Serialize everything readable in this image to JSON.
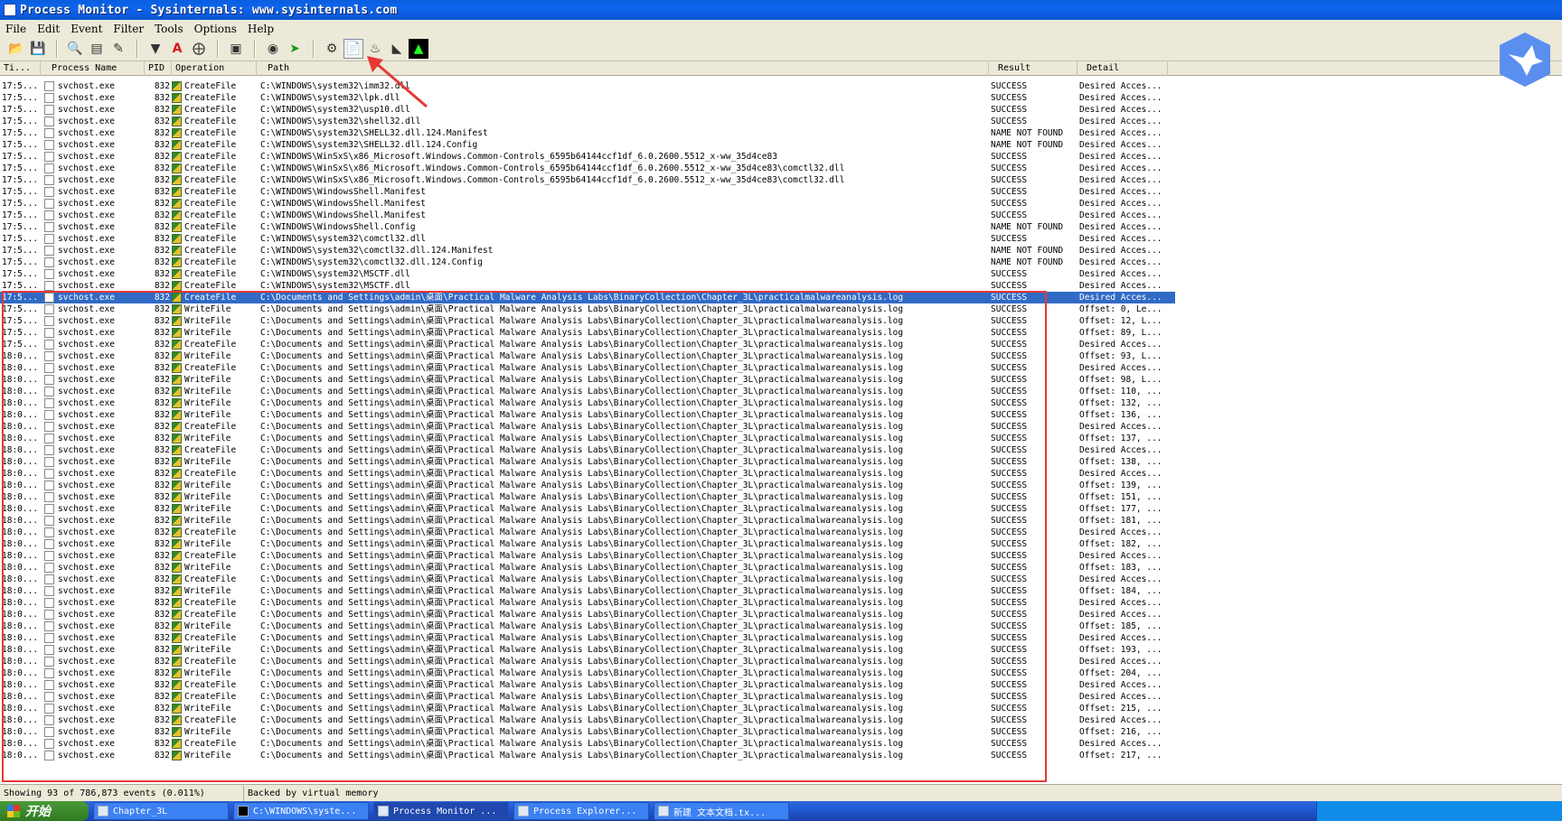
{
  "window": {
    "title": "Process Monitor - Sysinternals: www.sysinternals.com"
  },
  "menu": [
    "File",
    "Edit",
    "Event",
    "Filter",
    "Tools",
    "Options",
    "Help"
  ],
  "toolbar": {
    "buttons": [
      "open-icon",
      "save-icon",
      "magnify-icon",
      "autoscroll-icon",
      "clear-icon",
      "filter-icon",
      "highlight-icon",
      "network-icon",
      "jump-icon",
      "find-icon",
      "jump-to-icon",
      "registry-icon",
      "file-system-icon",
      "network-activity-icon",
      "process-activity-icon",
      "profiling-icon"
    ]
  },
  "columns": [
    "Ti...",
    "Process Name",
    "PID",
    "Operation",
    "Path",
    "Result",
    "Detail"
  ],
  "rows": [
    [
      "17:5...",
      "svchost.exe",
      "832",
      "CreateFile",
      "C:\\WINDOWS\\system32\\imm32.dll",
      "SUCCESS",
      "Desired Acces..."
    ],
    [
      "17:5...",
      "svchost.exe",
      "832",
      "CreateFile",
      "C:\\WINDOWS\\system32\\lpk.dll",
      "SUCCESS",
      "Desired Acces..."
    ],
    [
      "17:5...",
      "svchost.exe",
      "832",
      "CreateFile",
      "C:\\WINDOWS\\system32\\usp10.dll",
      "SUCCESS",
      "Desired Acces..."
    ],
    [
      "17:5...",
      "svchost.exe",
      "832",
      "CreateFile",
      "C:\\WINDOWS\\system32\\shell32.dll",
      "SUCCESS",
      "Desired Acces..."
    ],
    [
      "17:5...",
      "svchost.exe",
      "832",
      "CreateFile",
      "C:\\WINDOWS\\system32\\SHELL32.dll.124.Manifest",
      "NAME NOT FOUND",
      "Desired Acces..."
    ],
    [
      "17:5...",
      "svchost.exe",
      "832",
      "CreateFile",
      "C:\\WINDOWS\\system32\\SHELL32.dll.124.Config",
      "NAME NOT FOUND",
      "Desired Acces..."
    ],
    [
      "17:5...",
      "svchost.exe",
      "832",
      "CreateFile",
      "C:\\WINDOWS\\WinSxS\\x86_Microsoft.Windows.Common-Controls_6595b64144ccf1df_6.0.2600.5512_x-ww_35d4ce83",
      "SUCCESS",
      "Desired Acces..."
    ],
    [
      "17:5...",
      "svchost.exe",
      "832",
      "CreateFile",
      "C:\\WINDOWS\\WinSxS\\x86_Microsoft.Windows.Common-Controls_6595b64144ccf1df_6.0.2600.5512_x-ww_35d4ce83\\comctl32.dll",
      "SUCCESS",
      "Desired Acces..."
    ],
    [
      "17:5...",
      "svchost.exe",
      "832",
      "CreateFile",
      "C:\\WINDOWS\\WinSxS\\x86_Microsoft.Windows.Common-Controls_6595b64144ccf1df_6.0.2600.5512_x-ww_35d4ce83\\comctl32.dll",
      "SUCCESS",
      "Desired Acces..."
    ],
    [
      "17:5...",
      "svchost.exe",
      "832",
      "CreateFile",
      "C:\\WINDOWS\\WindowsShell.Manifest",
      "SUCCESS",
      "Desired Acces..."
    ],
    [
      "17:5...",
      "svchost.exe",
      "832",
      "CreateFile",
      "C:\\WINDOWS\\WindowsShell.Manifest",
      "SUCCESS",
      "Desired Acces..."
    ],
    [
      "17:5...",
      "svchost.exe",
      "832",
      "CreateFile",
      "C:\\WINDOWS\\WindowsShell.Manifest",
      "SUCCESS",
      "Desired Acces..."
    ],
    [
      "17:5...",
      "svchost.exe",
      "832",
      "CreateFile",
      "C:\\WINDOWS\\WindowsShell.Config",
      "NAME NOT FOUND",
      "Desired Acces..."
    ],
    [
      "17:5...",
      "svchost.exe",
      "832",
      "CreateFile",
      "C:\\WINDOWS\\system32\\comctl32.dll",
      "SUCCESS",
      "Desired Acces..."
    ],
    [
      "17:5...",
      "svchost.exe",
      "832",
      "CreateFile",
      "C:\\WINDOWS\\system32\\comctl32.dll.124.Manifest",
      "NAME NOT FOUND",
      "Desired Acces..."
    ],
    [
      "17:5...",
      "svchost.exe",
      "832",
      "CreateFile",
      "C:\\WINDOWS\\system32\\comctl32.dll.124.Config",
      "NAME NOT FOUND",
      "Desired Acces..."
    ],
    [
      "17:5...",
      "svchost.exe",
      "832",
      "CreateFile",
      "C:\\WINDOWS\\system32\\MSCTF.dll",
      "SUCCESS",
      "Desired Acces..."
    ],
    [
      "17:5...",
      "svchost.exe",
      "832",
      "CreateFile",
      "C:\\WINDOWS\\system32\\MSCTF.dll",
      "SUCCESS",
      "Desired Acces..."
    ],
    [
      "17:5...",
      "svchost.exe",
      "832",
      "CreateFile",
      "C:\\Documents and Settings\\admin\\桌面\\Practical Malware Analysis Labs\\BinaryCollection\\Chapter_3L\\practicalmalwareanalysis.log",
      "SUCCESS",
      "Desired Acces..."
    ],
    [
      "17:5...",
      "svchost.exe",
      "832",
      "WriteFile",
      "C:\\Documents and Settings\\admin\\桌面\\Practical Malware Analysis Labs\\BinaryCollection\\Chapter_3L\\practicalmalwareanalysis.log",
      "SUCCESS",
      "Offset: 0, Le..."
    ],
    [
      "17:5...",
      "svchost.exe",
      "832",
      "WriteFile",
      "C:\\Documents and Settings\\admin\\桌面\\Practical Malware Analysis Labs\\BinaryCollection\\Chapter_3L\\practicalmalwareanalysis.log",
      "SUCCESS",
      "Offset: 12, L..."
    ],
    [
      "17:5...",
      "svchost.exe",
      "832",
      "WriteFile",
      "C:\\Documents and Settings\\admin\\桌面\\Practical Malware Analysis Labs\\BinaryCollection\\Chapter_3L\\practicalmalwareanalysis.log",
      "SUCCESS",
      "Offset: 89, L..."
    ],
    [
      "17:5...",
      "svchost.exe",
      "832",
      "CreateFile",
      "C:\\Documents and Settings\\admin\\桌面\\Practical Malware Analysis Labs\\BinaryCollection\\Chapter_3L\\practicalmalwareanalysis.log",
      "SUCCESS",
      "Desired Acces..."
    ],
    [
      "18:0...",
      "svchost.exe",
      "832",
      "WriteFile",
      "C:\\Documents and Settings\\admin\\桌面\\Practical Malware Analysis Labs\\BinaryCollection\\Chapter_3L\\practicalmalwareanalysis.log",
      "SUCCESS",
      "Offset: 93, L..."
    ],
    [
      "18:0...",
      "svchost.exe",
      "832",
      "CreateFile",
      "C:\\Documents and Settings\\admin\\桌面\\Practical Malware Analysis Labs\\BinaryCollection\\Chapter_3L\\practicalmalwareanalysis.log",
      "SUCCESS",
      "Desired Acces..."
    ],
    [
      "18:0...",
      "svchost.exe",
      "832",
      "WriteFile",
      "C:\\Documents and Settings\\admin\\桌面\\Practical Malware Analysis Labs\\BinaryCollection\\Chapter_3L\\practicalmalwareanalysis.log",
      "SUCCESS",
      "Offset: 98, L..."
    ],
    [
      "18:0...",
      "svchost.exe",
      "832",
      "WriteFile",
      "C:\\Documents and Settings\\admin\\桌面\\Practical Malware Analysis Labs\\BinaryCollection\\Chapter_3L\\practicalmalwareanalysis.log",
      "SUCCESS",
      "Offset: 110, ..."
    ],
    [
      "18:0...",
      "svchost.exe",
      "832",
      "WriteFile",
      "C:\\Documents and Settings\\admin\\桌面\\Practical Malware Analysis Labs\\BinaryCollection\\Chapter_3L\\practicalmalwareanalysis.log",
      "SUCCESS",
      "Offset: 132, ..."
    ],
    [
      "18:0...",
      "svchost.exe",
      "832",
      "WriteFile",
      "C:\\Documents and Settings\\admin\\桌面\\Practical Malware Analysis Labs\\BinaryCollection\\Chapter_3L\\practicalmalwareanalysis.log",
      "SUCCESS",
      "Offset: 136, ..."
    ],
    [
      "18:0...",
      "svchost.exe",
      "832",
      "CreateFile",
      "C:\\Documents and Settings\\admin\\桌面\\Practical Malware Analysis Labs\\BinaryCollection\\Chapter_3L\\practicalmalwareanalysis.log",
      "SUCCESS",
      "Desired Acces..."
    ],
    [
      "18:0...",
      "svchost.exe",
      "832",
      "WriteFile",
      "C:\\Documents and Settings\\admin\\桌面\\Practical Malware Analysis Labs\\BinaryCollection\\Chapter_3L\\practicalmalwareanalysis.log",
      "SUCCESS",
      "Offset: 137, ..."
    ],
    [
      "18:0...",
      "svchost.exe",
      "832",
      "CreateFile",
      "C:\\Documents and Settings\\admin\\桌面\\Practical Malware Analysis Labs\\BinaryCollection\\Chapter_3L\\practicalmalwareanalysis.log",
      "SUCCESS",
      "Desired Acces..."
    ],
    [
      "18:0...",
      "svchost.exe",
      "832",
      "WriteFile",
      "C:\\Documents and Settings\\admin\\桌面\\Practical Malware Analysis Labs\\BinaryCollection\\Chapter_3L\\practicalmalwareanalysis.log",
      "SUCCESS",
      "Offset: 138, ..."
    ],
    [
      "18:0...",
      "svchost.exe",
      "832",
      "CreateFile",
      "C:\\Documents and Settings\\admin\\桌面\\Practical Malware Analysis Labs\\BinaryCollection\\Chapter_3L\\practicalmalwareanalysis.log",
      "SUCCESS",
      "Desired Acces..."
    ],
    [
      "18:0...",
      "svchost.exe",
      "832",
      "WriteFile",
      "C:\\Documents and Settings\\admin\\桌面\\Practical Malware Analysis Labs\\BinaryCollection\\Chapter_3L\\practicalmalwareanalysis.log",
      "SUCCESS",
      "Offset: 139, ..."
    ],
    [
      "18:0...",
      "svchost.exe",
      "832",
      "WriteFile",
      "C:\\Documents and Settings\\admin\\桌面\\Practical Malware Analysis Labs\\BinaryCollection\\Chapter_3L\\practicalmalwareanalysis.log",
      "SUCCESS",
      "Offset: 151, ..."
    ],
    [
      "18:0...",
      "svchost.exe",
      "832",
      "WriteFile",
      "C:\\Documents and Settings\\admin\\桌面\\Practical Malware Analysis Labs\\BinaryCollection\\Chapter_3L\\practicalmalwareanalysis.log",
      "SUCCESS",
      "Offset: 177, ..."
    ],
    [
      "18:0...",
      "svchost.exe",
      "832",
      "WriteFile",
      "C:\\Documents and Settings\\admin\\桌面\\Practical Malware Analysis Labs\\BinaryCollection\\Chapter_3L\\practicalmalwareanalysis.log",
      "SUCCESS",
      "Offset: 181, ..."
    ],
    [
      "18:0...",
      "svchost.exe",
      "832",
      "CreateFile",
      "C:\\Documents and Settings\\admin\\桌面\\Practical Malware Analysis Labs\\BinaryCollection\\Chapter_3L\\practicalmalwareanalysis.log",
      "SUCCESS",
      "Desired Acces..."
    ],
    [
      "18:0...",
      "svchost.exe",
      "832",
      "WriteFile",
      "C:\\Documents and Settings\\admin\\桌面\\Practical Malware Analysis Labs\\BinaryCollection\\Chapter_3L\\practicalmalwareanalysis.log",
      "SUCCESS",
      "Offset: 182, ..."
    ],
    [
      "18:0...",
      "svchost.exe",
      "832",
      "CreateFile",
      "C:\\Documents and Settings\\admin\\桌面\\Practical Malware Analysis Labs\\BinaryCollection\\Chapter_3L\\practicalmalwareanalysis.log",
      "SUCCESS",
      "Desired Acces..."
    ],
    [
      "18:0...",
      "svchost.exe",
      "832",
      "WriteFile",
      "C:\\Documents and Settings\\admin\\桌面\\Practical Malware Analysis Labs\\BinaryCollection\\Chapter_3L\\practicalmalwareanalysis.log",
      "SUCCESS",
      "Offset: 183, ..."
    ],
    [
      "18:0...",
      "svchost.exe",
      "832",
      "CreateFile",
      "C:\\Documents and Settings\\admin\\桌面\\Practical Malware Analysis Labs\\BinaryCollection\\Chapter_3L\\practicalmalwareanalysis.log",
      "SUCCESS",
      "Desired Acces..."
    ],
    [
      "18:0...",
      "svchost.exe",
      "832",
      "WriteFile",
      "C:\\Documents and Settings\\admin\\桌面\\Practical Malware Analysis Labs\\BinaryCollection\\Chapter_3L\\practicalmalwareanalysis.log",
      "SUCCESS",
      "Offset: 184, ..."
    ],
    [
      "18:0...",
      "svchost.exe",
      "832",
      "CreateFile",
      "C:\\Documents and Settings\\admin\\桌面\\Practical Malware Analysis Labs\\BinaryCollection\\Chapter_3L\\practicalmalwareanalysis.log",
      "SUCCESS",
      "Desired Acces..."
    ],
    [
      "18:0...",
      "svchost.exe",
      "832",
      "CreateFile",
      "C:\\Documents and Settings\\admin\\桌面\\Practical Malware Analysis Labs\\BinaryCollection\\Chapter_3L\\practicalmalwareanalysis.log",
      "SUCCESS",
      "Desired Acces..."
    ],
    [
      "18:0...",
      "svchost.exe",
      "832",
      "WriteFile",
      "C:\\Documents and Settings\\admin\\桌面\\Practical Malware Analysis Labs\\BinaryCollection\\Chapter_3L\\practicalmalwareanalysis.log",
      "SUCCESS",
      "Offset: 185, ..."
    ],
    [
      "18:0...",
      "svchost.exe",
      "832",
      "CreateFile",
      "C:\\Documents and Settings\\admin\\桌面\\Practical Malware Analysis Labs\\BinaryCollection\\Chapter_3L\\practicalmalwareanalysis.log",
      "SUCCESS",
      "Desired Acces..."
    ],
    [
      "18:0...",
      "svchost.exe",
      "832",
      "WriteFile",
      "C:\\Documents and Settings\\admin\\桌面\\Practical Malware Analysis Labs\\BinaryCollection\\Chapter_3L\\practicalmalwareanalysis.log",
      "SUCCESS",
      "Offset: 193, ..."
    ],
    [
      "18:0...",
      "svchost.exe",
      "832",
      "CreateFile",
      "C:\\Documents and Settings\\admin\\桌面\\Practical Malware Analysis Labs\\BinaryCollection\\Chapter_3L\\practicalmalwareanalysis.log",
      "SUCCESS",
      "Desired Acces..."
    ],
    [
      "18:0...",
      "svchost.exe",
      "832",
      "WriteFile",
      "C:\\Documents and Settings\\admin\\桌面\\Practical Malware Analysis Labs\\BinaryCollection\\Chapter_3L\\practicalmalwareanalysis.log",
      "SUCCESS",
      "Offset: 204, ..."
    ],
    [
      "18:0...",
      "svchost.exe",
      "832",
      "CreateFile",
      "C:\\Documents and Settings\\admin\\桌面\\Practical Malware Analysis Labs\\BinaryCollection\\Chapter_3L\\practicalmalwareanalysis.log",
      "SUCCESS",
      "Desired Acces..."
    ],
    [
      "18:0...",
      "svchost.exe",
      "832",
      "CreateFile",
      "C:\\Documents and Settings\\admin\\桌面\\Practical Malware Analysis Labs\\BinaryCollection\\Chapter_3L\\practicalmalwareanalysis.log",
      "SUCCESS",
      "Desired Acces..."
    ],
    [
      "18:0...",
      "svchost.exe",
      "832",
      "WriteFile",
      "C:\\Documents and Settings\\admin\\桌面\\Practical Malware Analysis Labs\\BinaryCollection\\Chapter_3L\\practicalmalwareanalysis.log",
      "SUCCESS",
      "Offset: 215, ..."
    ],
    [
      "18:0...",
      "svchost.exe",
      "832",
      "CreateFile",
      "C:\\Documents and Settings\\admin\\桌面\\Practical Malware Analysis Labs\\BinaryCollection\\Chapter_3L\\practicalmalwareanalysis.log",
      "SUCCESS",
      "Desired Acces..."
    ],
    [
      "18:0...",
      "svchost.exe",
      "832",
      "WriteFile",
      "C:\\Documents and Settings\\admin\\桌面\\Practical Malware Analysis Labs\\BinaryCollection\\Chapter_3L\\practicalmalwareanalysis.log",
      "SUCCESS",
      "Offset: 216, ..."
    ],
    [
      "18:0...",
      "svchost.exe",
      "832",
      "CreateFile",
      "C:\\Documents and Settings\\admin\\桌面\\Practical Malware Analysis Labs\\BinaryCollection\\Chapter_3L\\practicalmalwareanalysis.log",
      "SUCCESS",
      "Desired Acces..."
    ],
    [
      "18:0...",
      "svchost.exe",
      "832",
      "WriteFile",
      "C:\\Documents and Settings\\admin\\桌面\\Practical Malware Analysis Labs\\BinaryCollection\\Chapter_3L\\practicalmalwareanalysis.log",
      "SUCCESS",
      "Offset: 217, ..."
    ]
  ],
  "selected_row": 18,
  "status": {
    "events": "Showing 93 of 786,873 events (0.011%)",
    "memory": "Backed by virtual memory"
  },
  "taskbar": {
    "start": "开始",
    "tasks": [
      "Chapter_3L",
      "C:\\WINDOWS\\syste...",
      "Process Monitor ...",
      "Process Explorer...",
      "新建 文本文档.tx..."
    ]
  },
  "colors": {
    "title_bar": "#0b5ee0",
    "selected_row": "#316ac5",
    "highlight_box": "#e53935",
    "taskbar": "#245edb"
  }
}
